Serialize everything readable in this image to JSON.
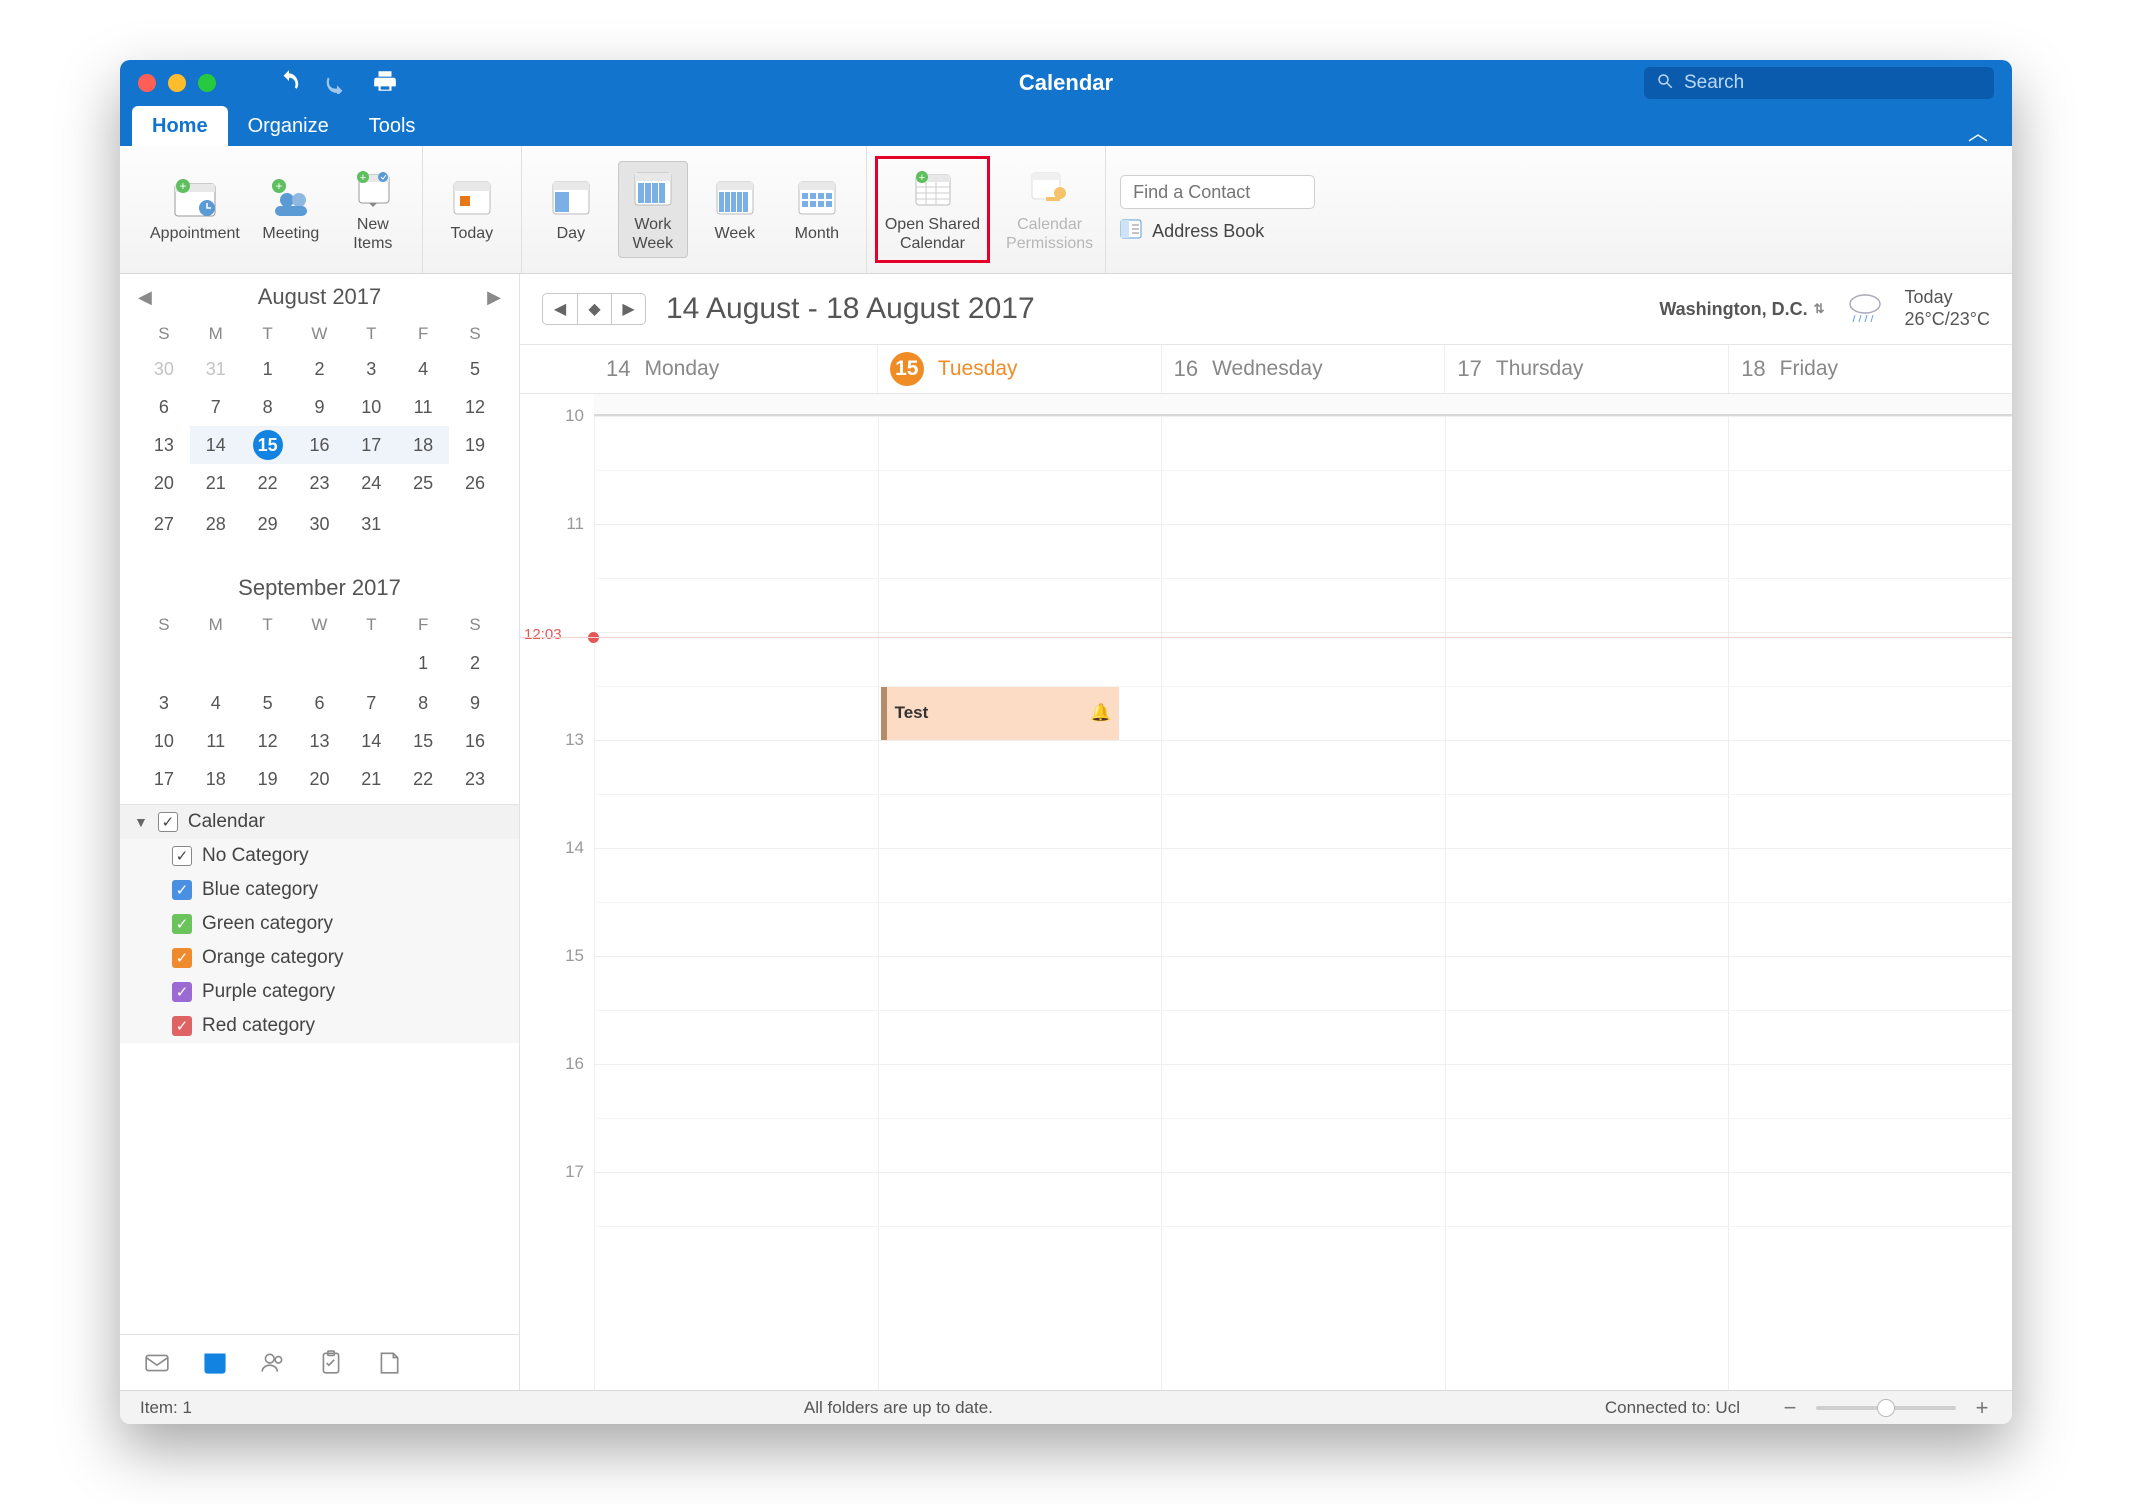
{
  "window": {
    "title": "Calendar"
  },
  "search": {
    "placeholder": "Search"
  },
  "tabs": {
    "t0": "Home",
    "t1": "Organize",
    "t2": "Tools"
  },
  "ribbon": {
    "appointment": "Appointment",
    "meeting": "Meeting",
    "newitems": "New\nItems",
    "today": "Today",
    "day": "Day",
    "workweek": "Work\nWeek",
    "week": "Week",
    "month": "Month",
    "openshared": "Open Shared\nCalendar",
    "permissions": "Calendar\nPermissions",
    "findcontact_ph": "Find a Contact",
    "addressbook": "Address Book"
  },
  "minical1": {
    "title": "August 2017",
    "dow": [
      "S",
      "M",
      "T",
      "W",
      "T",
      "F",
      "S"
    ],
    "rows": [
      [
        "30",
        "31",
        "1",
        "2",
        "3",
        "4",
        "5"
      ],
      [
        "6",
        "7",
        "8",
        "9",
        "10",
        "11",
        "12"
      ],
      [
        "13",
        "14",
        "15",
        "16",
        "17",
        "18",
        "19"
      ],
      [
        "20",
        "21",
        "22",
        "23",
        "24",
        "25",
        "26"
      ],
      [
        "27",
        "28",
        "29",
        "30",
        "31",
        "",
        ""
      ]
    ],
    "dim_first_n": 2,
    "today_row": 2,
    "today_col": 2,
    "wk_row": 2
  },
  "minical2": {
    "title": "September 2017",
    "dow": [
      "S",
      "M",
      "T",
      "W",
      "T",
      "F",
      "S"
    ],
    "rows": [
      [
        "",
        "",
        "",
        "",
        "",
        "1",
        "2"
      ],
      [
        "3",
        "4",
        "5",
        "6",
        "7",
        "8",
        "9"
      ],
      [
        "10",
        "11",
        "12",
        "13",
        "14",
        "15",
        "16"
      ],
      [
        "17",
        "18",
        "19",
        "20",
        "21",
        "22",
        "23"
      ]
    ]
  },
  "cats": {
    "header": "Calendar",
    "c0": "No Category",
    "c1": "Blue category",
    "c2": "Green category",
    "c3": "Orange category",
    "c4": "Purple category",
    "c5": "Red category"
  },
  "main": {
    "range": "14 August - 18 August 2017",
    "location": "Washington,  D.C.",
    "weather_today": "Today",
    "weather_temp": "26°C/23°C",
    "days": [
      {
        "num": "14",
        "name": "Monday"
      },
      {
        "num": "15",
        "name": "Tuesday"
      },
      {
        "num": "16",
        "name": "Wednesday"
      },
      {
        "num": "17",
        "name": "Thursday"
      },
      {
        "num": "18",
        "name": "Friday"
      }
    ],
    "hours": [
      "10",
      "11",
      "",
      "13",
      "14",
      "15",
      "16",
      "17"
    ],
    "now_label": "12:03",
    "event_title": "Test"
  },
  "status": {
    "items": "Item: 1",
    "sync": "All folders are up to date.",
    "conn": "Connected to: Ucl"
  }
}
